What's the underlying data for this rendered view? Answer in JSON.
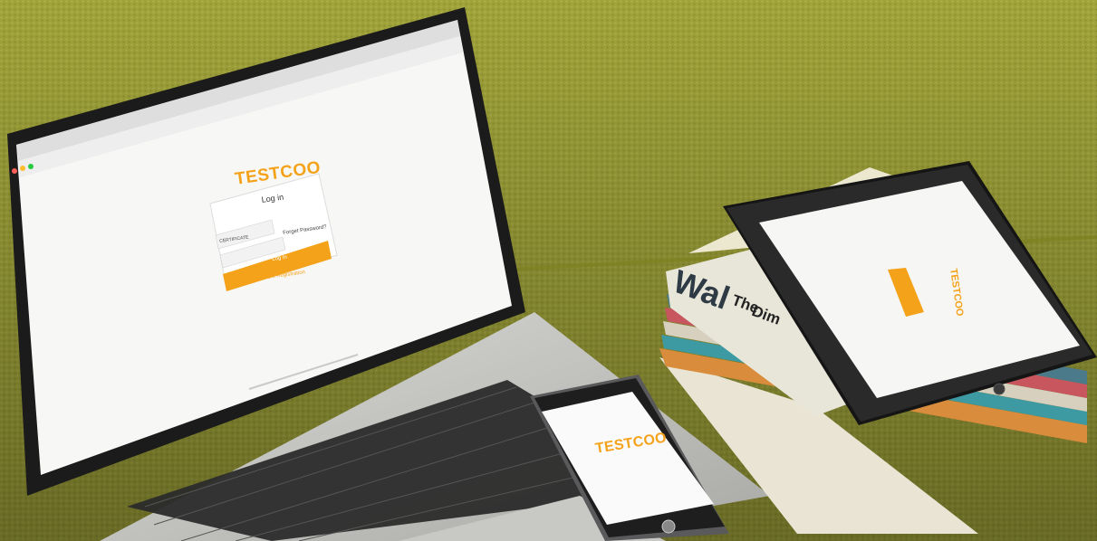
{
  "colors": {
    "background_fabric": "#a1a43a",
    "brand_orange": "#f5a21b",
    "device_black": "#1b1b1b",
    "screen_white": "#f7f7f5"
  },
  "laptop_screen": {
    "brand": "TESTCOO",
    "login_title": "Log in",
    "captcha_text": "CERTIFICATE",
    "forgot_password": "Forget Password?",
    "login_button": "Log In",
    "register_link": "Client Registration"
  },
  "phone_screen": {
    "brand": "TESTCOO"
  },
  "tablet_screen": {
    "brand": "TESTCOO"
  },
  "magazines": {
    "title_large": "Wal",
    "title_line1": "The",
    "title_line2": "Dim"
  }
}
